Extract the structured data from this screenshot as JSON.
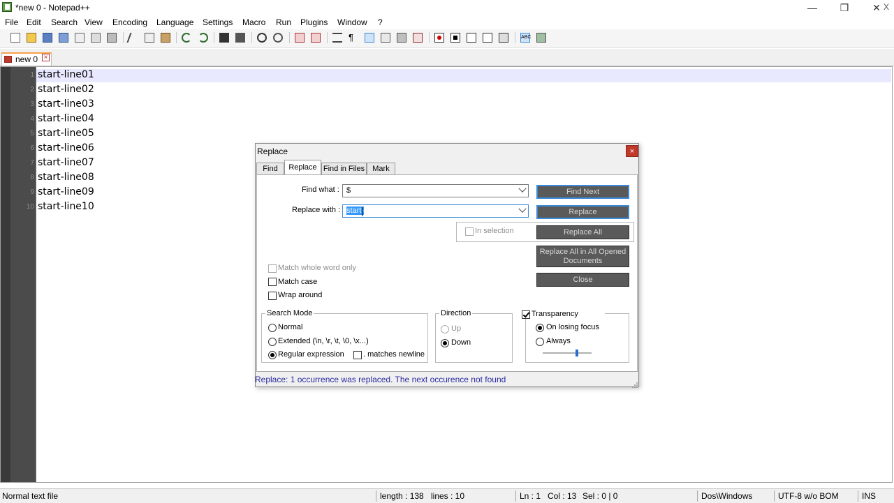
{
  "window": {
    "title": "*new 0 - Notepad++",
    "minimize_glyph": "—",
    "restore_glyph": "❐",
    "close_glyph": "✕"
  },
  "menu": [
    "File",
    "Edit",
    "Search",
    "View",
    "Encoding",
    "Language",
    "Settings",
    "Macro",
    "Run",
    "Plugins",
    "Window",
    "?"
  ],
  "menu_close_glyph": "X",
  "toolbar_icons": [
    "new-file-icon",
    "open-file-icon",
    "save-icon",
    "save-all-icon",
    "close-icon",
    "close-all-icon",
    "print-icon",
    "cut-icon",
    "copy-icon",
    "paste-icon",
    "undo-icon",
    "redo-icon",
    "find-icon",
    "replace-icon",
    "zoom-in-icon",
    "zoom-out-icon",
    "sync-v-icon",
    "sync-h-icon",
    "word-wrap-icon",
    "all-chars-icon",
    "indent-guide-icon",
    "udl-icon",
    "doc-map-icon",
    "function-list-icon",
    "macro-record-icon",
    "macro-stop-icon",
    "macro-play-icon",
    "macro-run-multiple-icon",
    "macro-save-icon",
    "spellcheck-icon",
    "plugin-icon"
  ],
  "tab": {
    "label": "new 0",
    "close_glyph": "×"
  },
  "editor": {
    "lines": [
      "start-line01",
      "start-line02",
      "start-line03",
      "start-line04",
      "start-line05",
      "start-line06",
      "start-line07",
      "start-line08",
      "start-line09",
      "start-line10"
    ]
  },
  "dialog": {
    "title": "Replace",
    "close_glyph": "×",
    "tabs": [
      "Find",
      "Replace",
      "Find in Files",
      "Mark"
    ],
    "find_what_label": "Find what :",
    "find_what_value": "$",
    "replace_with_label": "Replace with :",
    "replace_with_value": "start-",
    "in_selection_label": "In selection",
    "buttons": {
      "find_next": "Find Next",
      "replace": "Replace",
      "replace_all": "Replace All",
      "replace_all_opened": "Replace All in All Opened Documents",
      "close": "Close"
    },
    "options": {
      "match_whole_word": "Match whole word only",
      "match_case": "Match case",
      "wrap_around": "Wrap around"
    },
    "search_mode": {
      "title": "Search Mode",
      "normal": "Normal",
      "extended": "Extended (\\n, \\r, \\t, \\0, \\x...)",
      "regex": "Regular expression",
      "dot_newline": ". matches newline"
    },
    "direction": {
      "title": "Direction",
      "up": "Up",
      "down": "Down"
    },
    "transparency": {
      "title": "Transparency",
      "on_losing_focus": "On losing focus",
      "always": "Always",
      "level": 0.7
    },
    "status_message": "Replace: 1 occurrence was replaced. The next occurence not found"
  },
  "statusbar": {
    "file_type": "Normal text file",
    "length": "length : 138",
    "lines": "lines : 10",
    "ln": "Ln : 1",
    "col": "Col : 13",
    "sel": "Sel : 0 | 0",
    "eol": "Dos\\Windows",
    "encoding": "UTF-8 w/o BOM",
    "ins": "INS"
  },
  "colors": {
    "accent": "#3c8ad8",
    "current_line": "#e8e8ff",
    "status_msg": "#2a2aa0"
  }
}
